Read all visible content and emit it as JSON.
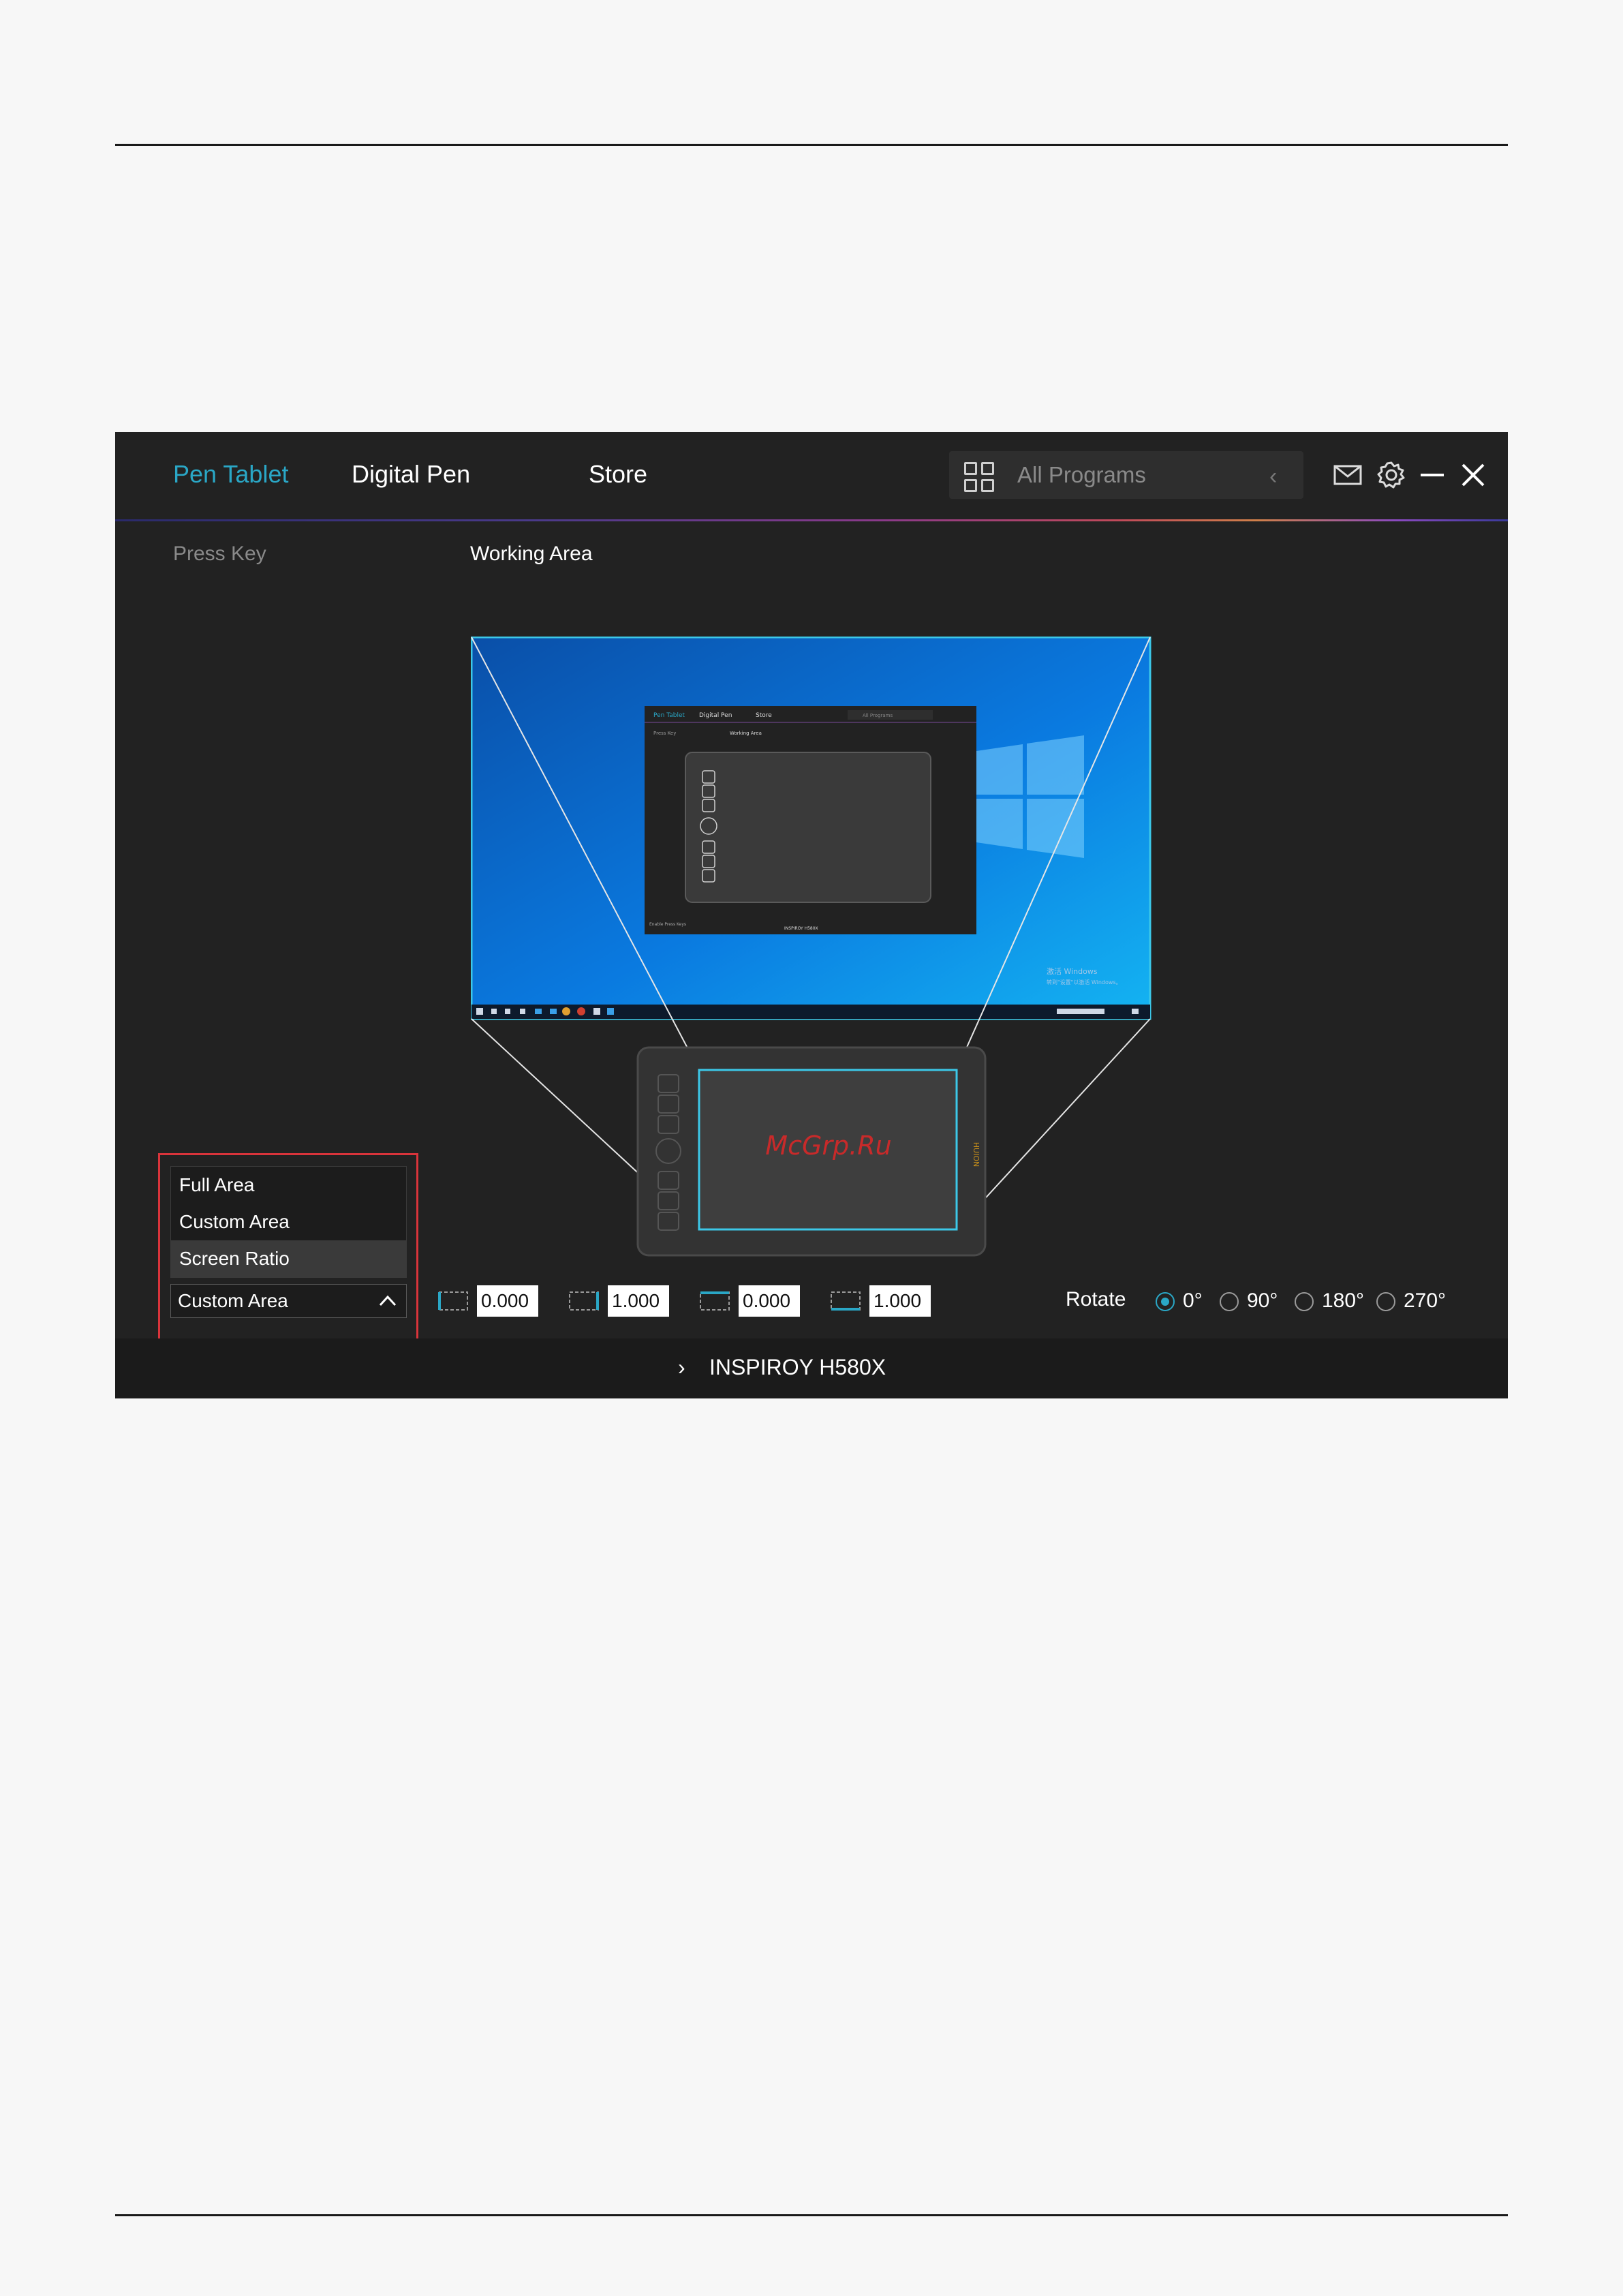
{
  "topbar": {
    "tabs": [
      {
        "label": "Pen Tablet",
        "active": true
      },
      {
        "label": "Digital Pen",
        "active": false
      },
      {
        "label": "Store",
        "active": false
      }
    ],
    "program_selector": {
      "label": "All Programs",
      "icon": "grid-icon"
    },
    "controls": [
      "mail-icon",
      "gear-icon",
      "minimize-icon",
      "close-icon"
    ]
  },
  "subnav": {
    "press_key": "Press Key",
    "working_area": "Working Area"
  },
  "preview": {
    "watermark": "McGrp.Ru",
    "tablet_brand": "HUION",
    "mini": {
      "tab1": "Pen Tablet",
      "tab2": "Digital Pen",
      "tab3": "Store",
      "programs": "All Programs",
      "press_key": "Press Key",
      "working_area": "Working Area",
      "enable": "Enable Press Keys",
      "device": "INSPIROY H580X"
    }
  },
  "area_dropdown": {
    "options": [
      "Full Area",
      "Custom Area",
      "Screen Ratio"
    ],
    "highlighted": "Screen Ratio",
    "selected": "Custom Area"
  },
  "coordinates": [
    {
      "icon": "left-edge-icon",
      "value": "0.000"
    },
    {
      "icon": "right-edge-icon",
      "value": "1.000"
    },
    {
      "icon": "top-edge-icon",
      "value": "0.000"
    },
    {
      "icon": "bottom-edge-icon",
      "value": "1.000"
    }
  ],
  "rotate": {
    "label": "Rotate",
    "options": [
      "0°",
      "90°",
      "180°",
      "270°"
    ],
    "selected": "0°"
  },
  "footer": {
    "device_name": "INSPIROY H580X"
  },
  "colors": {
    "accent": "#2aa7c6",
    "highlight_border": "#d9343b",
    "background": "#222222"
  }
}
